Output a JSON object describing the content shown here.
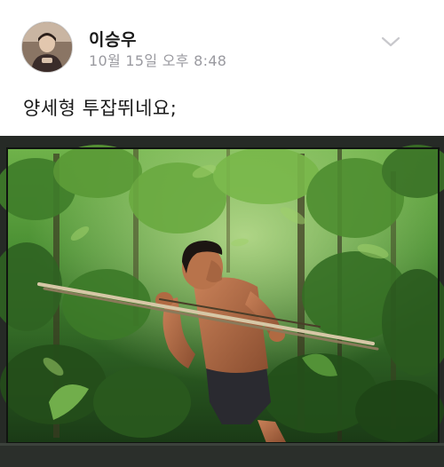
{
  "post": {
    "author": {
      "name": "이승우",
      "timestamp": "10월 15일 오후 8:48"
    },
    "menu_icon": "chevron-down-icon",
    "text": "양세형 투잡뛰네요;",
    "photo": {
      "subject": "jungle-hunter-photo"
    }
  },
  "colors": {
    "name": "#1a1a1a",
    "timestamp": "#9a9aa0",
    "chevron": "#c8c8cc",
    "frame": "#1a1f1a",
    "foliage_dark": "#1f4a1c",
    "foliage_light": "#5ea53a",
    "skin": "#b5704a"
  }
}
